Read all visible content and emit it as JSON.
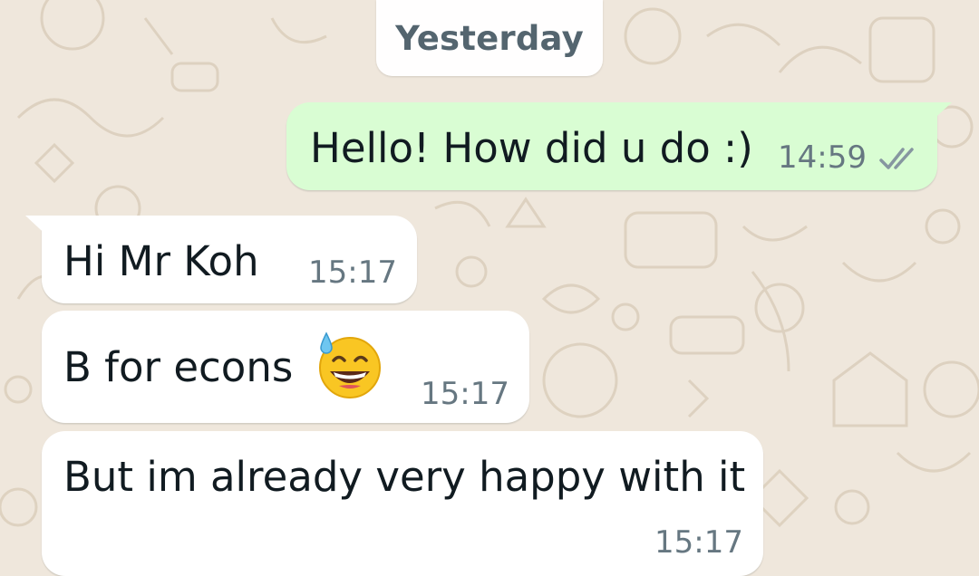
{
  "chat": {
    "date_separator": "Yesterday",
    "messages": [
      {
        "direction": "outgoing",
        "text": "Hello! How did u do :)",
        "time": "14:59",
        "status_icon": "double-check-icon"
      },
      {
        "direction": "incoming",
        "text": "Hi Mr Koh",
        "time": "15:17"
      },
      {
        "direction": "incoming",
        "text": "B for econs",
        "emoji": "grinning-face-with-sweat-icon",
        "time": "15:17"
      },
      {
        "direction": "incoming",
        "text": "But im already very happy with it",
        "time": "15:17"
      }
    ]
  },
  "colors": {
    "wallpaper": "#efe7dc",
    "outgoing_bubble": "#d9fdd3",
    "incoming_bubble": "#ffffff",
    "timestamp": "#667781"
  }
}
